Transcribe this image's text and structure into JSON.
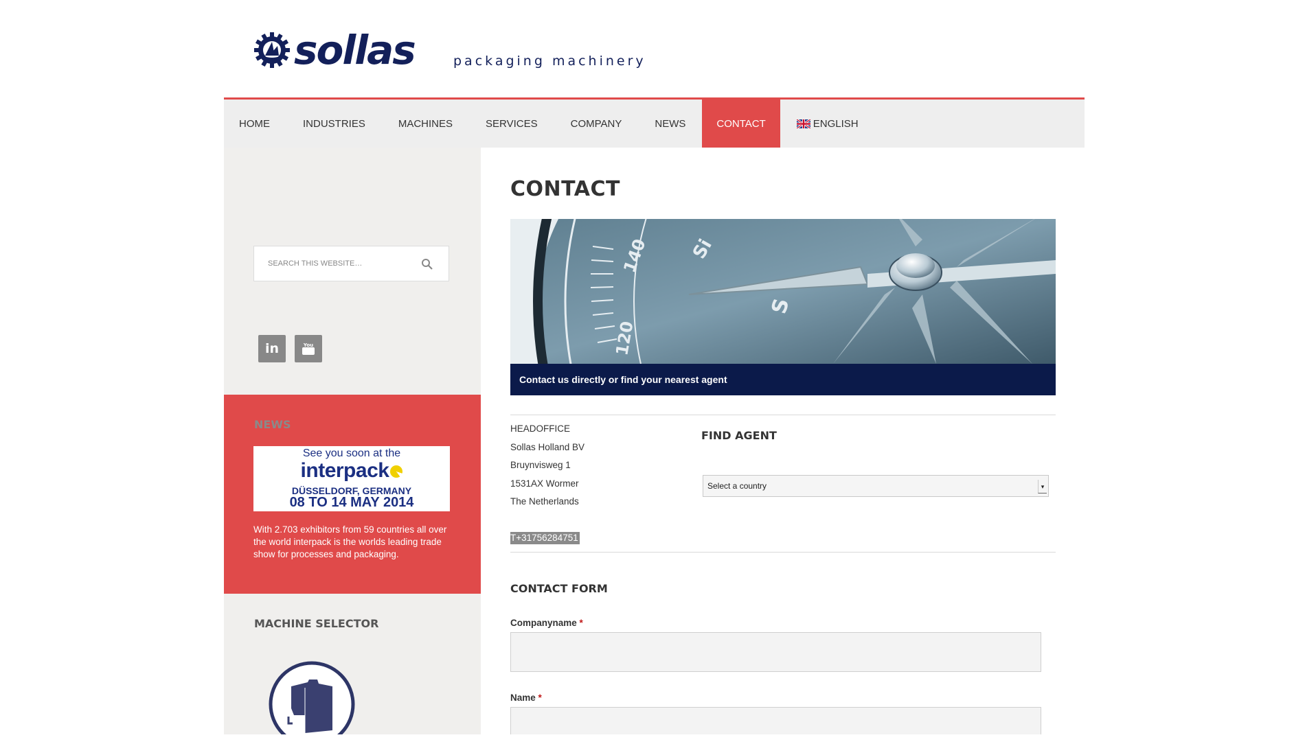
{
  "header": {
    "logo_text": "sollas",
    "tagline": "packaging machinery"
  },
  "nav": {
    "items": [
      {
        "label": "HOME"
      },
      {
        "label": "INDUSTRIES"
      },
      {
        "label": "MACHINES"
      },
      {
        "label": "SERVICES"
      },
      {
        "label": "COMPANY"
      },
      {
        "label": "NEWS"
      },
      {
        "label": "CONTACT",
        "active": true
      },
      {
        "label": "ENGLISH",
        "icon": "uk-flag-icon"
      }
    ]
  },
  "sidebar": {
    "search": {
      "placeholder": "SEARCH THIS WEBSITE…"
    },
    "social": [
      {
        "label": "in",
        "icon": "linkedin-icon"
      },
      {
        "label": "You",
        "icon": "youtube-icon"
      }
    ],
    "news": {
      "title": "NEWS",
      "banner": {
        "line1": "See you soon at the",
        "brand": "interpack",
        "city": "DÜSSELDORF, GERMANY",
        "dates": "08 TO 14 MAY 2014"
      },
      "text": "With 2.703 exhibitors from 59 countries all over the world interpack is the worlds leading trade show for processes and packaging."
    },
    "machine_selector": {
      "title": "MACHINE SELECTOR"
    }
  },
  "main": {
    "title": "CONTACT",
    "hero_caption": "Contact us directly or find your nearest agent",
    "address": {
      "lines": [
        "HEADOFFICE",
        "Sollas Holland BV",
        "Bruynvisweg 1",
        "1531AX Wormer",
        "The Netherlands"
      ],
      "phone": "T+31756284751"
    },
    "find_agent": {
      "title": "FIND AGENT",
      "select_value": "Select a country"
    },
    "form": {
      "title": "CONTACT FORM",
      "fields": [
        {
          "label": "Companyname",
          "required": "*"
        },
        {
          "label": "Name",
          "required": "*"
        }
      ]
    }
  },
  "colors": {
    "accent": "#e04a4a",
    "brand_navy": "#13205a",
    "caption_bg": "#0b1a4a",
    "nav_bg": "#eeeeee",
    "sidebar_bg": "#f0efed"
  }
}
